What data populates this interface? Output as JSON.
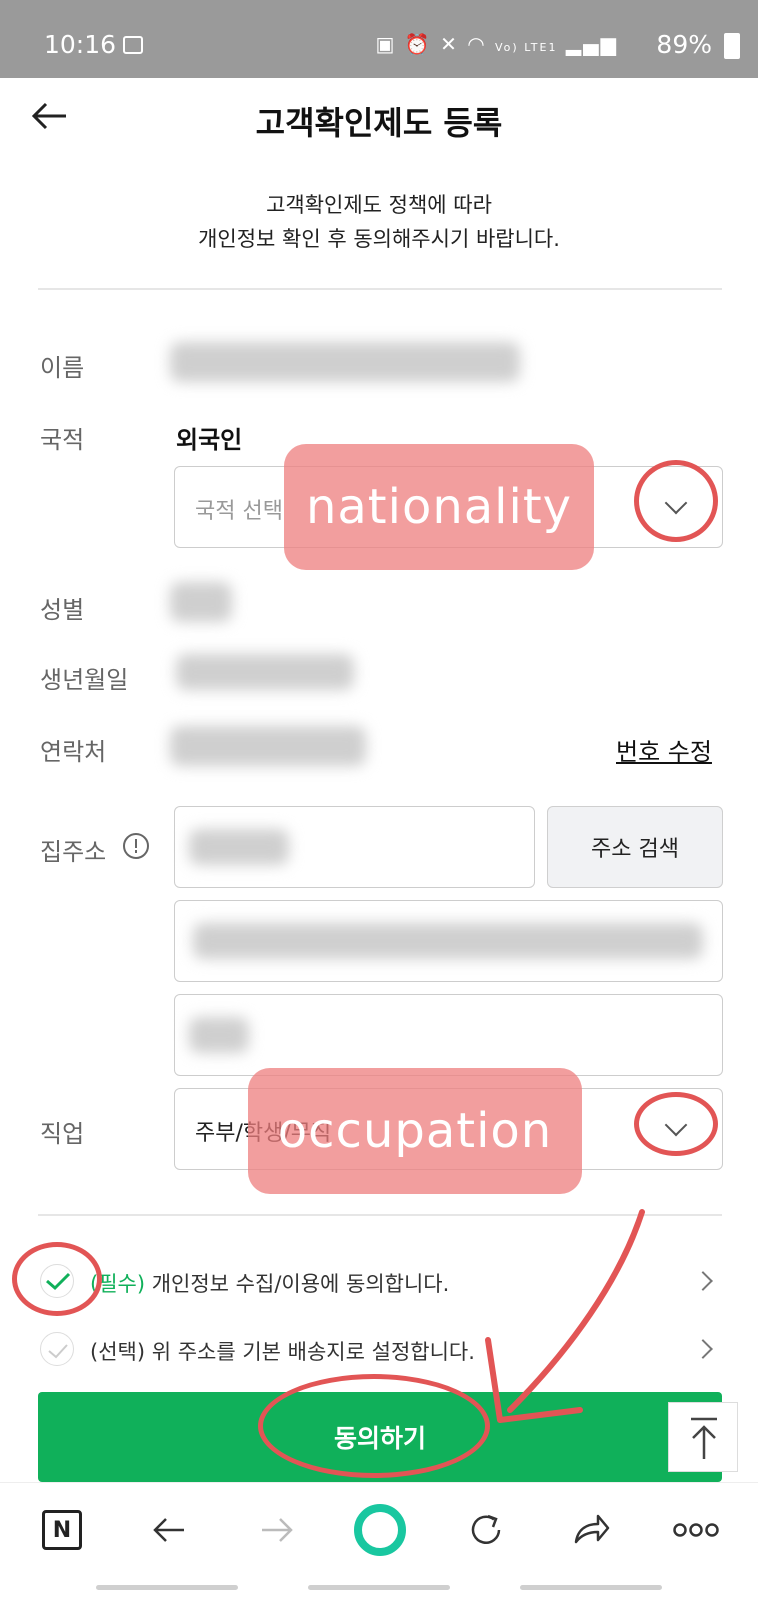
{
  "status_bar": {
    "time": "10:16",
    "battery": "89%",
    "icons": [
      "image-icon",
      "battery-saver-icon",
      "alarm-icon",
      "mute-icon",
      "wifi-icon",
      "volte-icon",
      "signal-icon",
      "battery-icon"
    ],
    "volte": "Vo) LTE1"
  },
  "header": {
    "title": "고객확인제도 등록",
    "back_icon": "arrow-left-icon"
  },
  "intro": {
    "line1": "고객확인제도 정책에 따라",
    "line2": "개인정보 확인 후 동의해주시기 바랍니다."
  },
  "form": {
    "name_label": "이름",
    "nationality_label": "국적",
    "nationality_value": "외국인",
    "nationality_select_placeholder": "국적 선택",
    "gender_label": "성별",
    "birth_label": "생년월일",
    "contact_label": "연락처",
    "edit_phone_link": "번호 수정",
    "address_label": "집주소",
    "address_info_icon": "info-icon",
    "address_search_button": "주소 검색",
    "occupation_label": "직업",
    "occupation_value": "주부/학생/무직"
  },
  "annotations": {
    "nationality": "nationality",
    "occupation": "occupation",
    "color": "#e25555"
  },
  "agreements": [
    {
      "prefix": "(필수)",
      "text": "개인정보 수집/이용에 동의합니다.",
      "checked": true
    },
    {
      "prefix": "(선택)",
      "text": "위 주소를 기본 배송지로 설정합니다.",
      "checked": false
    }
  ],
  "submit_button": "동의하기",
  "bottom_nav": {
    "n_label": "N",
    "items": [
      "naver-n-icon",
      "back-arrow-icon",
      "forward-arrow-icon",
      "green-dot-icon",
      "refresh-icon",
      "share-icon",
      "more-icon"
    ]
  },
  "colors": {
    "accent_green": "#10b05a",
    "status_bar": "#9a9a9a",
    "annotation_red": "#e25555"
  }
}
